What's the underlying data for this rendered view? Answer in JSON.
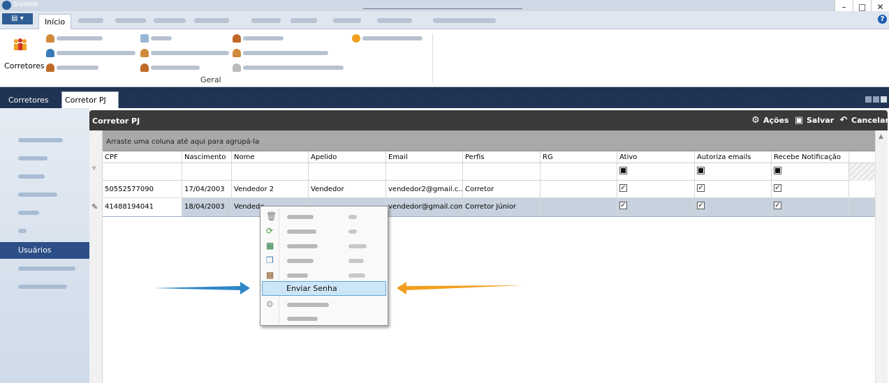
{
  "window": {
    "app_title": "SisWeb",
    "minimize": "–",
    "restore": "🗗",
    "close": "✕"
  },
  "ribbon": {
    "active_tab": "Início",
    "corretores_label": "Corretores",
    "group_label": "Geral",
    "help": "?"
  },
  "doc_tabs": {
    "corretores": "Corretores",
    "corretor_pj": "Corretor PJ"
  },
  "left_nav": {
    "active_item": "Usuários"
  },
  "panel": {
    "title": "Corretor PJ",
    "actions": [
      {
        "label": "Ações",
        "icon": "gear-icon"
      },
      {
        "label": "Salvar",
        "icon": "save-icon"
      },
      {
        "label": "Cancelar",
        "icon": "undo-icon"
      }
    ],
    "group_hint": "Arraste uma coluna até aqui para agrupá-la"
  },
  "grid": {
    "columns": [
      "CPF",
      "Nascimento",
      "Nome",
      "Apelido",
      "Email",
      "Perfis",
      "RG",
      "Ativo",
      "Autoriza emails",
      "Recebe Notificação"
    ],
    "rows": [
      {
        "cpf": "50552577090",
        "nascimento": "17/04/2003",
        "nome": "Vendedor 2",
        "apelido": "Vendedor",
        "email": "vendedor2@gmail.c...",
        "perfis": "Corretor",
        "rg": "",
        "ativo": true,
        "autoriza": true,
        "recebe": true
      },
      {
        "cpf": "41488194041",
        "nascimento": "18/04/2003",
        "nome": "Vendedo",
        "apelido": "",
        "email": "vendedor@gmail.com",
        "perfis": "Corretor Júnior",
        "rg": "",
        "ativo": true,
        "autoriza": true,
        "recebe": true
      }
    ]
  },
  "context_menu": {
    "highlighted_item": "Enviar Senha"
  },
  "colors": {
    "arrow_blue": "#2e86c8",
    "arrow_orange": "#f0a020",
    "nav_active": "#2b4f86",
    "header_dark": "#3a3a3a"
  }
}
